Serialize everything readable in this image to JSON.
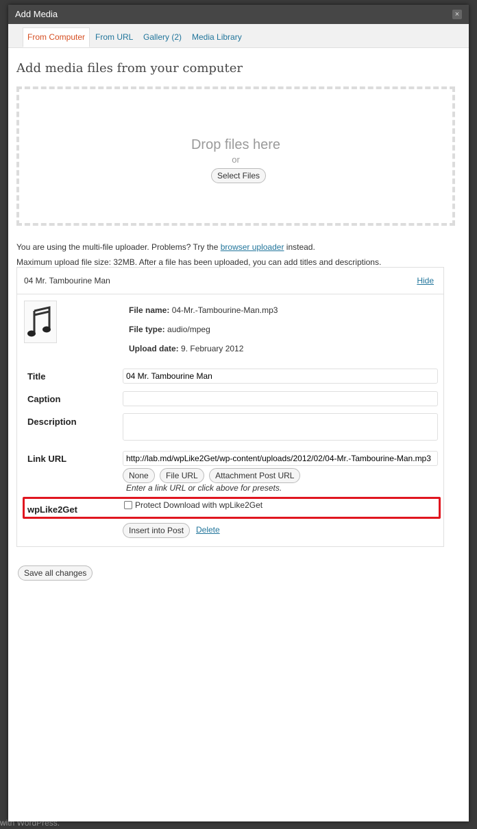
{
  "background": {
    "footer_fragment": "with WordPress."
  },
  "dialog": {
    "title": "Add Media",
    "close_symbol": "×"
  },
  "tabs": [
    {
      "label": "From Computer",
      "active": true
    },
    {
      "label": "From URL",
      "active": false
    },
    {
      "label": "Gallery (2)",
      "active": false
    },
    {
      "label": "Media Library",
      "active": false
    }
  ],
  "upload": {
    "heading": "Add media files from your computer",
    "drop_title": "Drop files here",
    "drop_or": "or",
    "select_files": "Select Files",
    "multi_prefix": "You are using the multi-file uploader. Problems? Try the ",
    "browser_uploader_link": "browser uploader",
    "multi_suffix": " instead.",
    "max_size_text": "Maximum upload file size: 32MB. After a file has been uploaded, you can add titles and descriptions."
  },
  "item": {
    "title": "04 Mr. Tambourine Man",
    "hide": "Hide",
    "thumb_icon": "music-note-icon",
    "file_name_label": "File name:",
    "file_name": "04-Mr.-Tambourine-Man.mp3",
    "file_type_label": "File type:",
    "file_type": "audio/mpeg",
    "upload_date_label": "Upload date:",
    "upload_date": "9. February 2012",
    "fields": {
      "title_label": "Title",
      "title_value": "04 Mr. Tambourine Man",
      "caption_label": "Caption",
      "caption_value": "",
      "description_label": "Description",
      "description_value": "",
      "link_label": "Link URL",
      "link_value": "http://lab.md/wpLike2Get/wp-content/uploads/2012/02/04-Mr.-Tambourine-Man.mp3"
    },
    "presets": {
      "none": "None",
      "file_url": "File URL",
      "attachment_post_url": "Attachment Post URL",
      "hint": "Enter a link URL or click above for presets."
    },
    "plugin": {
      "label": "wpLike2Get",
      "checkbox_label": "Protect Download with wpLike2Get",
      "checked": false,
      "highlight_color": "#e0161f"
    },
    "insert_into_post": "Insert into Post",
    "delete": "Delete"
  },
  "save_all": "Save all changes",
  "colors": {
    "link": "#21759b",
    "active_tab": "#d54e21",
    "titlebar": "#464646"
  }
}
